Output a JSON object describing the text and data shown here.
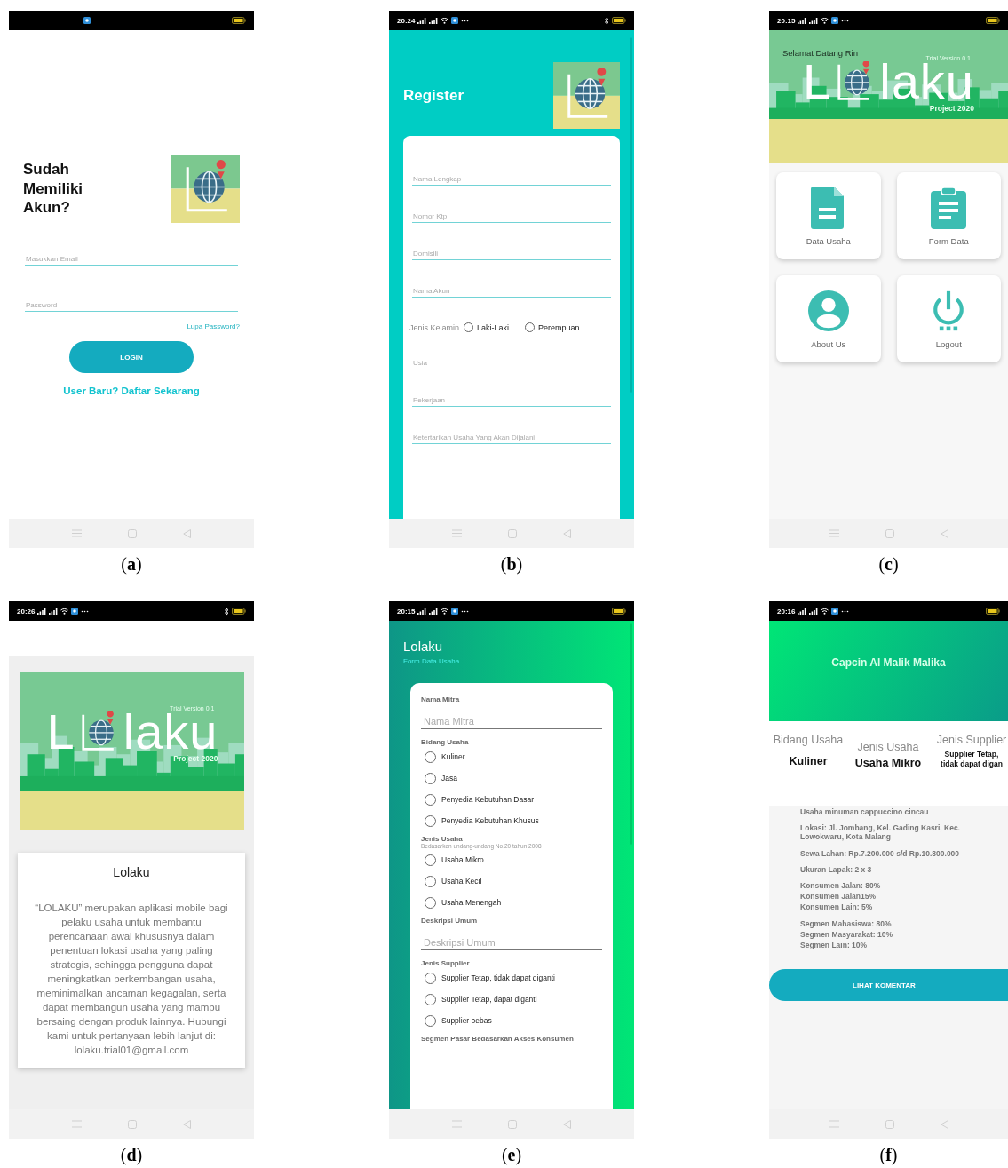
{
  "panels": [
    {
      "kind": "login",
      "caption": "(**a**)",
      "status_bar": {
        "bluetooth": false
      },
      "title": "Sudah Memiliki Akun?",
      "fields": [
        {
          "placeholder": "Masukkan Email"
        },
        {
          "placeholder": "Password"
        }
      ],
      "forgot_link": "Lupa Password?",
      "login_button": "LOGIN",
      "signup_link": "User Baru? Daftar Sekarang"
    },
    {
      "kind": "register",
      "caption": "(**b**)",
      "status_bar": {
        "time": "20:24",
        "bluetooth": true
      },
      "title": "Register",
      "items": [
        {
          "kind": "field",
          "placeholder": "Nama Lengkap"
        },
        {
          "kind": "field",
          "placeholder": "Nomor Ktp"
        },
        {
          "kind": "field",
          "placeholder": "Domisili"
        },
        {
          "kind": "field",
          "placeholder": "Nama Akun"
        },
        {
          "kind": "radio_group",
          "label": "Jenis Kelamin",
          "options": [
            {
              "label": "Laki-Laki",
              "selected": false
            },
            {
              "label": "Perempuan",
              "selected": false
            }
          ]
        },
        {
          "kind": "field",
          "placeholder": "Usia"
        },
        {
          "kind": "field",
          "placeholder": "Pekerjaan"
        },
        {
          "kind": "field",
          "placeholder": "Ketertarikan Usaha Yang Akan Dijalani"
        }
      ]
    },
    {
      "kind": "home",
      "caption": "(**c**)",
      "status_bar": {
        "time": "20:15",
        "bluetooth": false
      },
      "greeting": "Selamat Datang Rin",
      "banner": {
        "logo_start": "L",
        "logo_end": "laku",
        "version": "Trial Version 0.1",
        "project": "Project 2020"
      },
      "menu": [
        {
          "label": "Data Usaha"
        },
        {
          "label": "Form Data"
        },
        {
          "label": "About Us"
        },
        {
          "label": "Logout"
        }
      ]
    },
    {
      "kind": "about",
      "caption": "(**d**)",
      "status_bar": {
        "time": "20:26",
        "bluetooth": true
      },
      "banner": {
        "logo_start": "L",
        "logo_end": "laku",
        "version": "Trial Version 0.1",
        "project": "Project 2020"
      },
      "card": {
        "title": "Lolaku",
        "text": "“LOLAKU” merupakan aplikasi mobile bagi pelaku usaha untuk membantu perencanaan awal khususnya dalam penentuan lokasi usaha yang paling strategis, sehingga pengguna dapat meningkatkan perkembangan usaha, meminimalkan ancaman kegagalan, serta dapat membangun usaha yang mampu bersaing dengan produk lainnya. Hubungi kami untuk pertanyaan lebih lanjut di: lolaku.trial01@gmail.com"
      }
    },
    {
      "kind": "form",
      "caption": "(**e**)",
      "status_bar": {
        "time": "20:15",
        "bluetooth": false
      },
      "title": "Lolaku",
      "subtitle": "Form Data Usaha",
      "items": [
        {
          "kind": "label",
          "text": "Nama Mitra"
        },
        {
          "kind": "input",
          "placeholder": "Nama Mitra"
        },
        {
          "kind": "label",
          "text": "Bidang Usaha"
        },
        {
          "kind": "radio",
          "label": "Kuliner",
          "selected": false
        },
        {
          "kind": "radio",
          "label": "Jasa",
          "selected": false
        },
        {
          "kind": "radio",
          "label": "Penyedia Kebutuhan Dasar",
          "selected": false
        },
        {
          "kind": "radio",
          "label": "Penyedia Kebutuhan Khusus",
          "selected": false
        },
        {
          "kind": "label",
          "text": "Jenis Usaha",
          "note": "Bedasarkan undang-undang No.20 tahun 2008"
        },
        {
          "kind": "radio",
          "label": "Usaha Mikro",
          "selected": false
        },
        {
          "kind": "radio",
          "label": "Usaha Kecil",
          "selected": false
        },
        {
          "kind": "radio",
          "label": "Usaha Menengah",
          "selected": false
        },
        {
          "kind": "label",
          "text": "Deskripsi Umum"
        },
        {
          "kind": "input",
          "placeholder": "Deskripsi Umum"
        },
        {
          "kind": "label",
          "text": "Jenis Supplier"
        },
        {
          "kind": "radio",
          "label": "Supplier Tetap, tidak dapat diganti",
          "selected": false
        },
        {
          "kind": "radio",
          "label": "Supplier Tetap, dapat diganti",
          "selected": false
        },
        {
          "kind": "radio",
          "label": "Supplier bebas",
          "selected": false
        },
        {
          "kind": "label",
          "text": "Segmen Pasar Bedasarkan Akses Konsumen"
        }
      ]
    },
    {
      "kind": "detail",
      "caption": "(**f**)",
      "status_bar": {
        "time": "20:16",
        "bluetooth": false
      },
      "title": "Capcin Al Malik Malika",
      "stats": [
        {
          "heading": "Bidang Usaha",
          "value": "Kuliner"
        },
        {
          "heading": "Jenis Usaha",
          "value": "Usaha Mikro"
        },
        {
          "heading": "Jenis Supplier",
          "value": "Supplier Tetap,\ntidak dapat digan"
        }
      ],
      "info": [
        [
          "Usaha minuman cappuccino cincau"
        ],
        [
          "Lokasi: Jl. Jombang, Kel. Gading Kasri, Kec. Lowokwaru, Kota Malang"
        ],
        [
          "Sewa Lahan: Rp.7.200.000 s/d Rp.10.800.000"
        ],
        [
          "Ukuran Lapak: 2 x 3"
        ],
        [
          "Konsumen Jalan: 80%",
          "Konsumen Jalan15%",
          "Konsumen Lain: 5%"
        ],
        [
          "Segmen Mahasiswa: 80%",
          "Segmen Masyarakat: 10%",
          "Segmen Lain: 10%"
        ]
      ],
      "button": "LIHAT KOMENTAR"
    }
  ]
}
